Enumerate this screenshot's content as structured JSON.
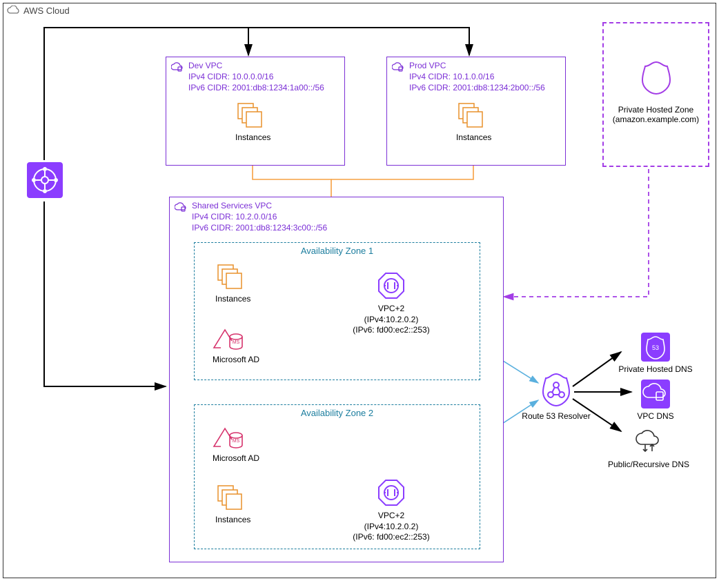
{
  "cloud": {
    "label": "AWS Cloud"
  },
  "vpcs": {
    "dev": {
      "name": "Dev VPC",
      "ipv4": "IPv4 CIDR: 10.0.0.0/16",
      "ipv6": "IPv6 CIDR: 2001:db8:1234:1a00::/56",
      "instances_label": "Instances"
    },
    "prod": {
      "name": "Prod VPC",
      "ipv4": "IPv4 CIDR: 10.1.0.0/16",
      "ipv6": "IPv6 CIDR: 2001:db8:1234:2b00::/56",
      "instances_label": "Instances"
    },
    "shared": {
      "name": "Shared Services VPC",
      "ipv4": "IPv4 CIDR: 10.2.0.0/16",
      "ipv6": "IPv6 CIDR: 2001:db8:1234:3c00::/56"
    }
  },
  "az1": {
    "title": "Availability Zone 1",
    "instances_label": "Instances",
    "ad_label": "Microsoft AD",
    "vpc2_label": "VPC+2",
    "vpc2_ipv4": "(IPv4:10.2.0.2)",
    "vpc2_ipv6": "(IPv6: fd00:ec2::253)"
  },
  "az2": {
    "title": "Availability Zone 2",
    "instances_label": "Instances",
    "ad_label": "Microsoft AD",
    "vpc2_label": "VPC+2",
    "vpc2_ipv4": "(IPv4:10.2.0.2)",
    "vpc2_ipv6": "(IPv6: fd00:ec2::253)"
  },
  "resolver": {
    "label": "Route 53 Resolver"
  },
  "dns": {
    "private": "Private Hosted DNS",
    "vpc": "VPC DNS",
    "public": "Public/Recursive DNS"
  },
  "hosted_zone": {
    "title": "Private Hosted Zone",
    "domain": "(amazon.example.com)"
  },
  "tgw_label": ""
}
